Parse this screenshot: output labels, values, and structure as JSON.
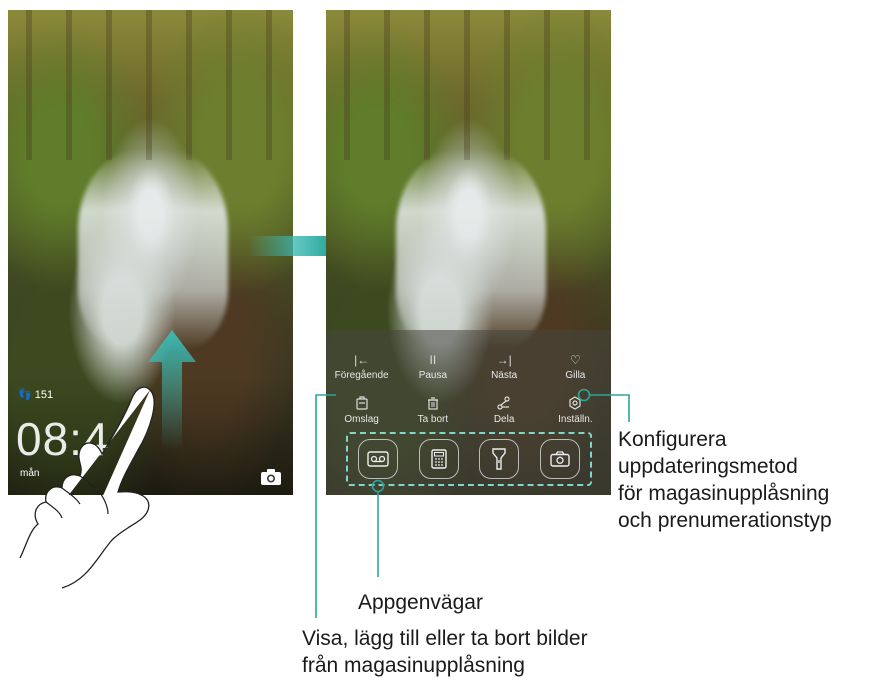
{
  "left_screen": {
    "step_count": "151",
    "clock": "08:4",
    "date": "mån"
  },
  "right_screen": {
    "controls_row1": [
      {
        "icon": "previous-icon",
        "glyph": "|←",
        "label": "Föregående"
      },
      {
        "icon": "pause-icon",
        "glyph": "II",
        "label": "Pausa"
      },
      {
        "icon": "next-icon",
        "glyph": "→|",
        "label": "Nästa"
      },
      {
        "icon": "heart-icon",
        "glyph": "♡",
        "label": "Gilla"
      }
    ],
    "controls_row2": [
      {
        "icon": "cover-icon",
        "label": "Omslag"
      },
      {
        "icon": "trash-icon",
        "glyph": "🗑",
        "label": "Ta bort"
      },
      {
        "icon": "share-icon",
        "label": "Dela"
      },
      {
        "icon": "settings-icon",
        "glyph": "⚙",
        "label": "Inställn."
      }
    ],
    "shortcuts": [
      "recorder-icon",
      "calculator-icon",
      "flashlight-icon",
      "camera-icon"
    ]
  },
  "callouts": {
    "settings": [
      "Konfigurera",
      "uppdateringsmetod",
      "för magasinupplåsning",
      "och prenumerationstyp"
    ],
    "shortcuts": "Appgenvägar",
    "cover": [
      "Visa, lägg till eller ta bort bilder",
      "från magasinupplåsning"
    ]
  },
  "colors": {
    "accent": "#2bb3a8",
    "callout_line": "#2ba69b",
    "dashed_box": "#7fd6c9"
  }
}
